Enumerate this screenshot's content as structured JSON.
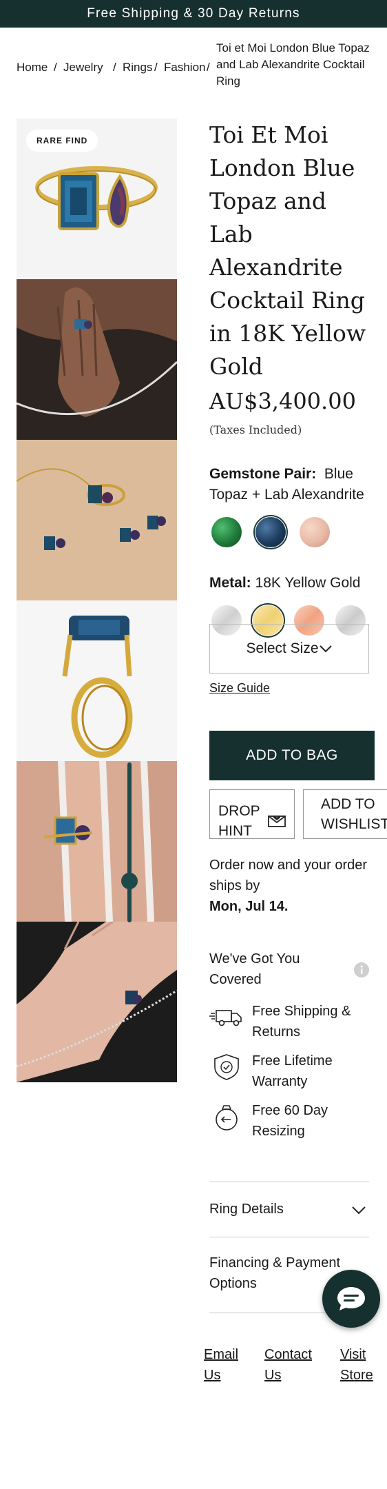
{
  "banner": {
    "text": "Free Shipping & 30 Day Returns"
  },
  "breadcrumb": {
    "items": [
      "Home",
      "Jewelry",
      "Rings",
      "Fashion"
    ],
    "separator": "/",
    "current": "Toi et Moi London Blue Topaz and Lab Alexandrite Cocktail Ring"
  },
  "gallery": {
    "badge": "RARE FIND"
  },
  "product": {
    "title": "Toi Et Moi London Blue Topaz and Lab Alexandrite Cocktail Ring in 18K Yellow Gold",
    "price": "AU$3,400.00",
    "tax_note": "(Taxes Included)"
  },
  "gemstone": {
    "label": "Gemstone Pair:",
    "value": "Blue Topaz + Lab Alexandrite",
    "options": [
      {
        "name": "emerald",
        "color": "#1f7a3a"
      },
      {
        "name": "blue-topaz",
        "color": "#1d3b5c",
        "selected": true
      },
      {
        "name": "morganite",
        "color": "#e9b9a6"
      }
    ]
  },
  "metal": {
    "label": "Metal:",
    "value": "18K Yellow Gold",
    "options": [
      {
        "name": "white-gold",
        "color": "#e6e6e6"
      },
      {
        "name": "yellow-gold",
        "color": "#f3dc8a",
        "selected": true
      },
      {
        "name": "rose-gold",
        "color": "#f2b094"
      },
      {
        "name": "platinum",
        "color": "#e0e0e0"
      }
    ]
  },
  "size": {
    "select_label": "Select Size",
    "guide": "Size Guide"
  },
  "actions": {
    "add_to_bag": "ADD TO BAG",
    "drop_hint": "DROP HINT",
    "add_to_wishlist": "ADD TO WISHLIST"
  },
  "shipping": {
    "text": "Order now and your order ships by",
    "date": "Mon, Jul 14."
  },
  "covered": {
    "title": "We've Got You Covered",
    "perks": [
      {
        "icon": "truck-icon",
        "label": "Free Shipping & Returns"
      },
      {
        "icon": "shield-check-icon",
        "label": "Free Lifetime Warranty"
      },
      {
        "icon": "ring-resize-icon",
        "label": "Free 60 Day Resizing"
      }
    ]
  },
  "accordions": [
    {
      "label": "Ring Details"
    },
    {
      "label": "Financing & Payment Options"
    }
  ],
  "footer_links": [
    "Email Us",
    "Contact Us",
    "Visit Store"
  ],
  "colors": {
    "brand": "#16302f",
    "accent": "#1c4a4a"
  }
}
